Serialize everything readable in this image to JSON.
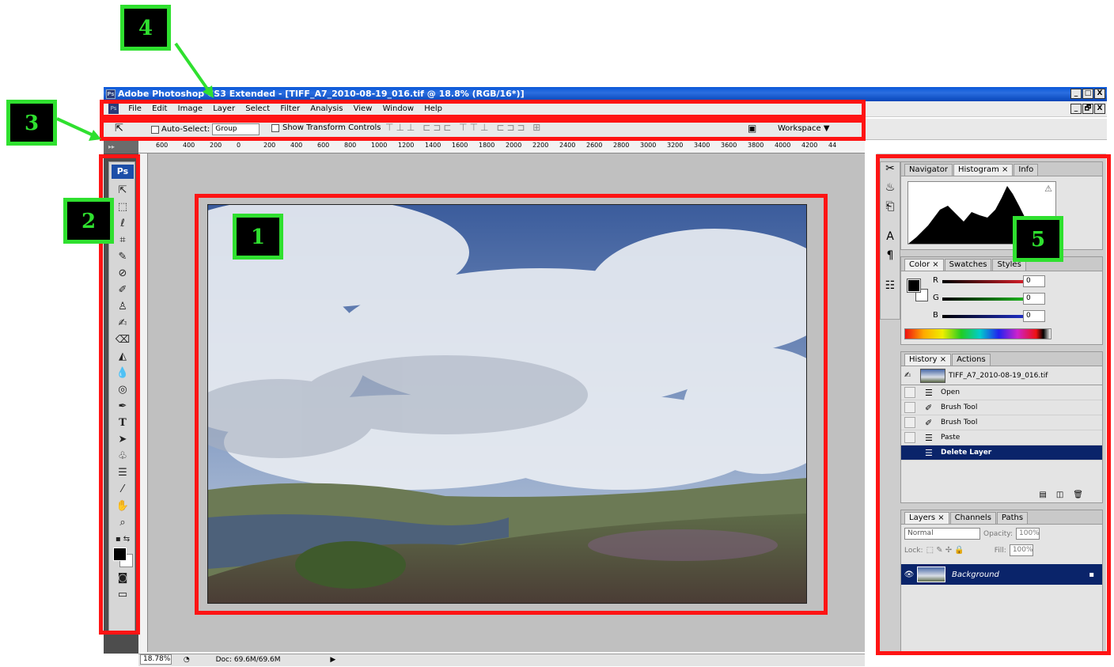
{
  "window": {
    "title": "Adobe Photoshop CS3 Extended - [TIFF_A7_2010-08-19_016.tif @ 18.8% (RGB/16*)]",
    "app_icon": "Ps",
    "buttons": [
      "_",
      "□",
      "X"
    ],
    "doc_buttons": [
      "_",
      "🗗",
      "X"
    ]
  },
  "menu": [
    "File",
    "Edit",
    "Image",
    "Layer",
    "Select",
    "Filter",
    "Analysis",
    "View",
    "Window",
    "Help"
  ],
  "options": {
    "auto_select_label": "Auto-Select:",
    "auto_select_value": "Group",
    "transform_label": "Show Transform Controls",
    "workspace_label": "Workspace ▼"
  },
  "ruler_ticks": [
    "600",
    "400",
    "200",
    "0",
    "200",
    "400",
    "600",
    "800",
    "1000",
    "1200",
    "1400",
    "1600",
    "1800",
    "2000",
    "2200",
    "2400",
    "2600",
    "2800",
    "3000",
    "3200",
    "3400",
    "3600",
    "3800",
    "4000",
    "4200",
    "44"
  ],
  "toolbar": {
    "logo": "Ps",
    "collapse_label": "▸▸"
  },
  "status": {
    "zoom": "18.78%",
    "doc": "Doc: 69.6M/69.6M"
  },
  "navigator_tabs": [
    "Navigator",
    "Histogram ×",
    "Info"
  ],
  "color_tabs": [
    "Color ×",
    "Swatches",
    "Styles"
  ],
  "color": {
    "channels": [
      {
        "name": "R",
        "value": "0",
        "color": "#e0202a"
      },
      {
        "name": "G",
        "value": "0",
        "color": "#20c020"
      },
      {
        "name": "B",
        "value": "0",
        "color": "#2030d0"
      }
    ]
  },
  "history_tabs": [
    "History ×",
    "Actions"
  ],
  "history": {
    "snapshot": "TIFF_A7_2010-08-19_016.tif",
    "items": [
      {
        "label": "Open",
        "icon": "document-icon"
      },
      {
        "label": "Brush Tool",
        "icon": "brush-icon"
      },
      {
        "label": "Brush Tool",
        "icon": "brush-icon"
      },
      {
        "label": "Paste",
        "icon": "document-icon"
      },
      {
        "label": "Delete Layer",
        "icon": "document-icon",
        "selected": true
      }
    ]
  },
  "layers_tabs": [
    "Layers ×",
    "Channels",
    "Paths"
  ],
  "layers": {
    "blend_mode": "Normal",
    "opacity_label": "Opacity:",
    "opacity": "100%",
    "lock_label": "Lock:",
    "fill_label": "Fill:",
    "fill": "100%",
    "items": [
      {
        "name": "Background"
      }
    ]
  },
  "annotations": [
    "1",
    "2",
    "3",
    "4",
    "5"
  ],
  "colors": {
    "annotation_red": "#ff1414",
    "annotation_green": "#2fe02f",
    "selection": "#0a246a"
  }
}
